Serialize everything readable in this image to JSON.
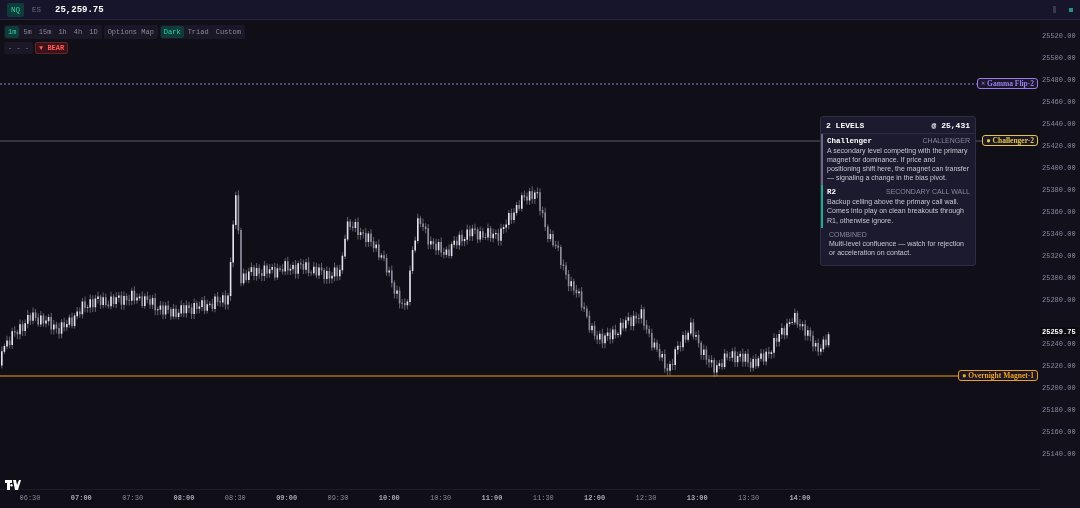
{
  "symbols": [
    {
      "label": "NQ",
      "selected": true
    },
    {
      "label": "ES",
      "selected": false
    }
  ],
  "price": "25,259.75",
  "timeframes": [
    {
      "label": "1m",
      "selected": true
    },
    {
      "label": "5m",
      "selected": false
    },
    {
      "label": "15m",
      "selected": false
    },
    {
      "label": "1h",
      "selected": false
    },
    {
      "label": "4h",
      "selected": false
    },
    {
      "label": "1D",
      "selected": false
    }
  ],
  "options_map": {
    "label": "Options Map"
  },
  "themes": [
    {
      "label": "Dark",
      "selected": true
    },
    {
      "label": "Triad",
      "selected": false
    },
    {
      "label": "Custom",
      "selected": false
    }
  ],
  "line_style": {
    "label": "- - -"
  },
  "bias": {
    "label": "▼ BEAR"
  },
  "levels": [
    {
      "marker": "×",
      "label": "Gamma Flip-2",
      "kind": "flip",
      "color": "#9b7cf0"
    },
    {
      "marker": "●",
      "label": "Challenger-2",
      "kind": "challenger",
      "color": "#e8c547"
    },
    {
      "marker": "●",
      "label": "Overnight Magnet-1",
      "kind": "magnet",
      "color": "#f0a020"
    }
  ],
  "price_axis": [
    "25520.00",
    "25500.00",
    "25480.00",
    "25460.00",
    "25440.00",
    "25420.00",
    "25400.00",
    "25380.00",
    "25360.00",
    "25340.00",
    "25320.00",
    "25300.00",
    "25280.00",
    "25240.00",
    "25220.00",
    "25200.00",
    "25180.00",
    "25160.00",
    "25140.00"
  ],
  "current_price": "25259.75",
  "time_axis": [
    {
      "label": "06:30",
      "hour": false
    },
    {
      "label": "07:00",
      "hour": true
    },
    {
      "label": "07:30",
      "hour": false
    },
    {
      "label": "08:00",
      "hour": true
    },
    {
      "label": "08:30",
      "hour": false
    },
    {
      "label": "09:00",
      "hour": true
    },
    {
      "label": "09:30",
      "hour": false
    },
    {
      "label": "10:00",
      "hour": true
    },
    {
      "label": "10:30",
      "hour": false
    },
    {
      "label": "11:00",
      "hour": true
    },
    {
      "label": "11:30",
      "hour": false
    },
    {
      "label": "12:00",
      "hour": true
    },
    {
      "label": "12:30",
      "hour": false
    },
    {
      "label": "13:00",
      "hour": true
    },
    {
      "label": "13:30",
      "hour": false
    },
    {
      "label": "14:00",
      "hour": true
    }
  ],
  "tooltip": {
    "title": "2 LEVELS",
    "price": "@ 25,431",
    "sections": [
      {
        "kind": "level",
        "name": "Challenger",
        "tag": "CHALLENGER",
        "color": "#6b6880",
        "text": "A secondary level competing with the primary magnet for dominance. If price and positioning shift here, the magnet can transfer — signaling a change in the bias pivot."
      },
      {
        "kind": "level",
        "name": "R2",
        "tag": "SECONDARY CALL WALL",
        "color": "#1fae8c",
        "text": "Backup ceiling above the primary call wall. Comes into play on clean breakouts through R1, otherwise ignore."
      },
      {
        "kind": "combined",
        "name": "COMBINED",
        "text": "Multi-level confluence — watch for rejection or acceleration on contact."
      }
    ]
  }
}
